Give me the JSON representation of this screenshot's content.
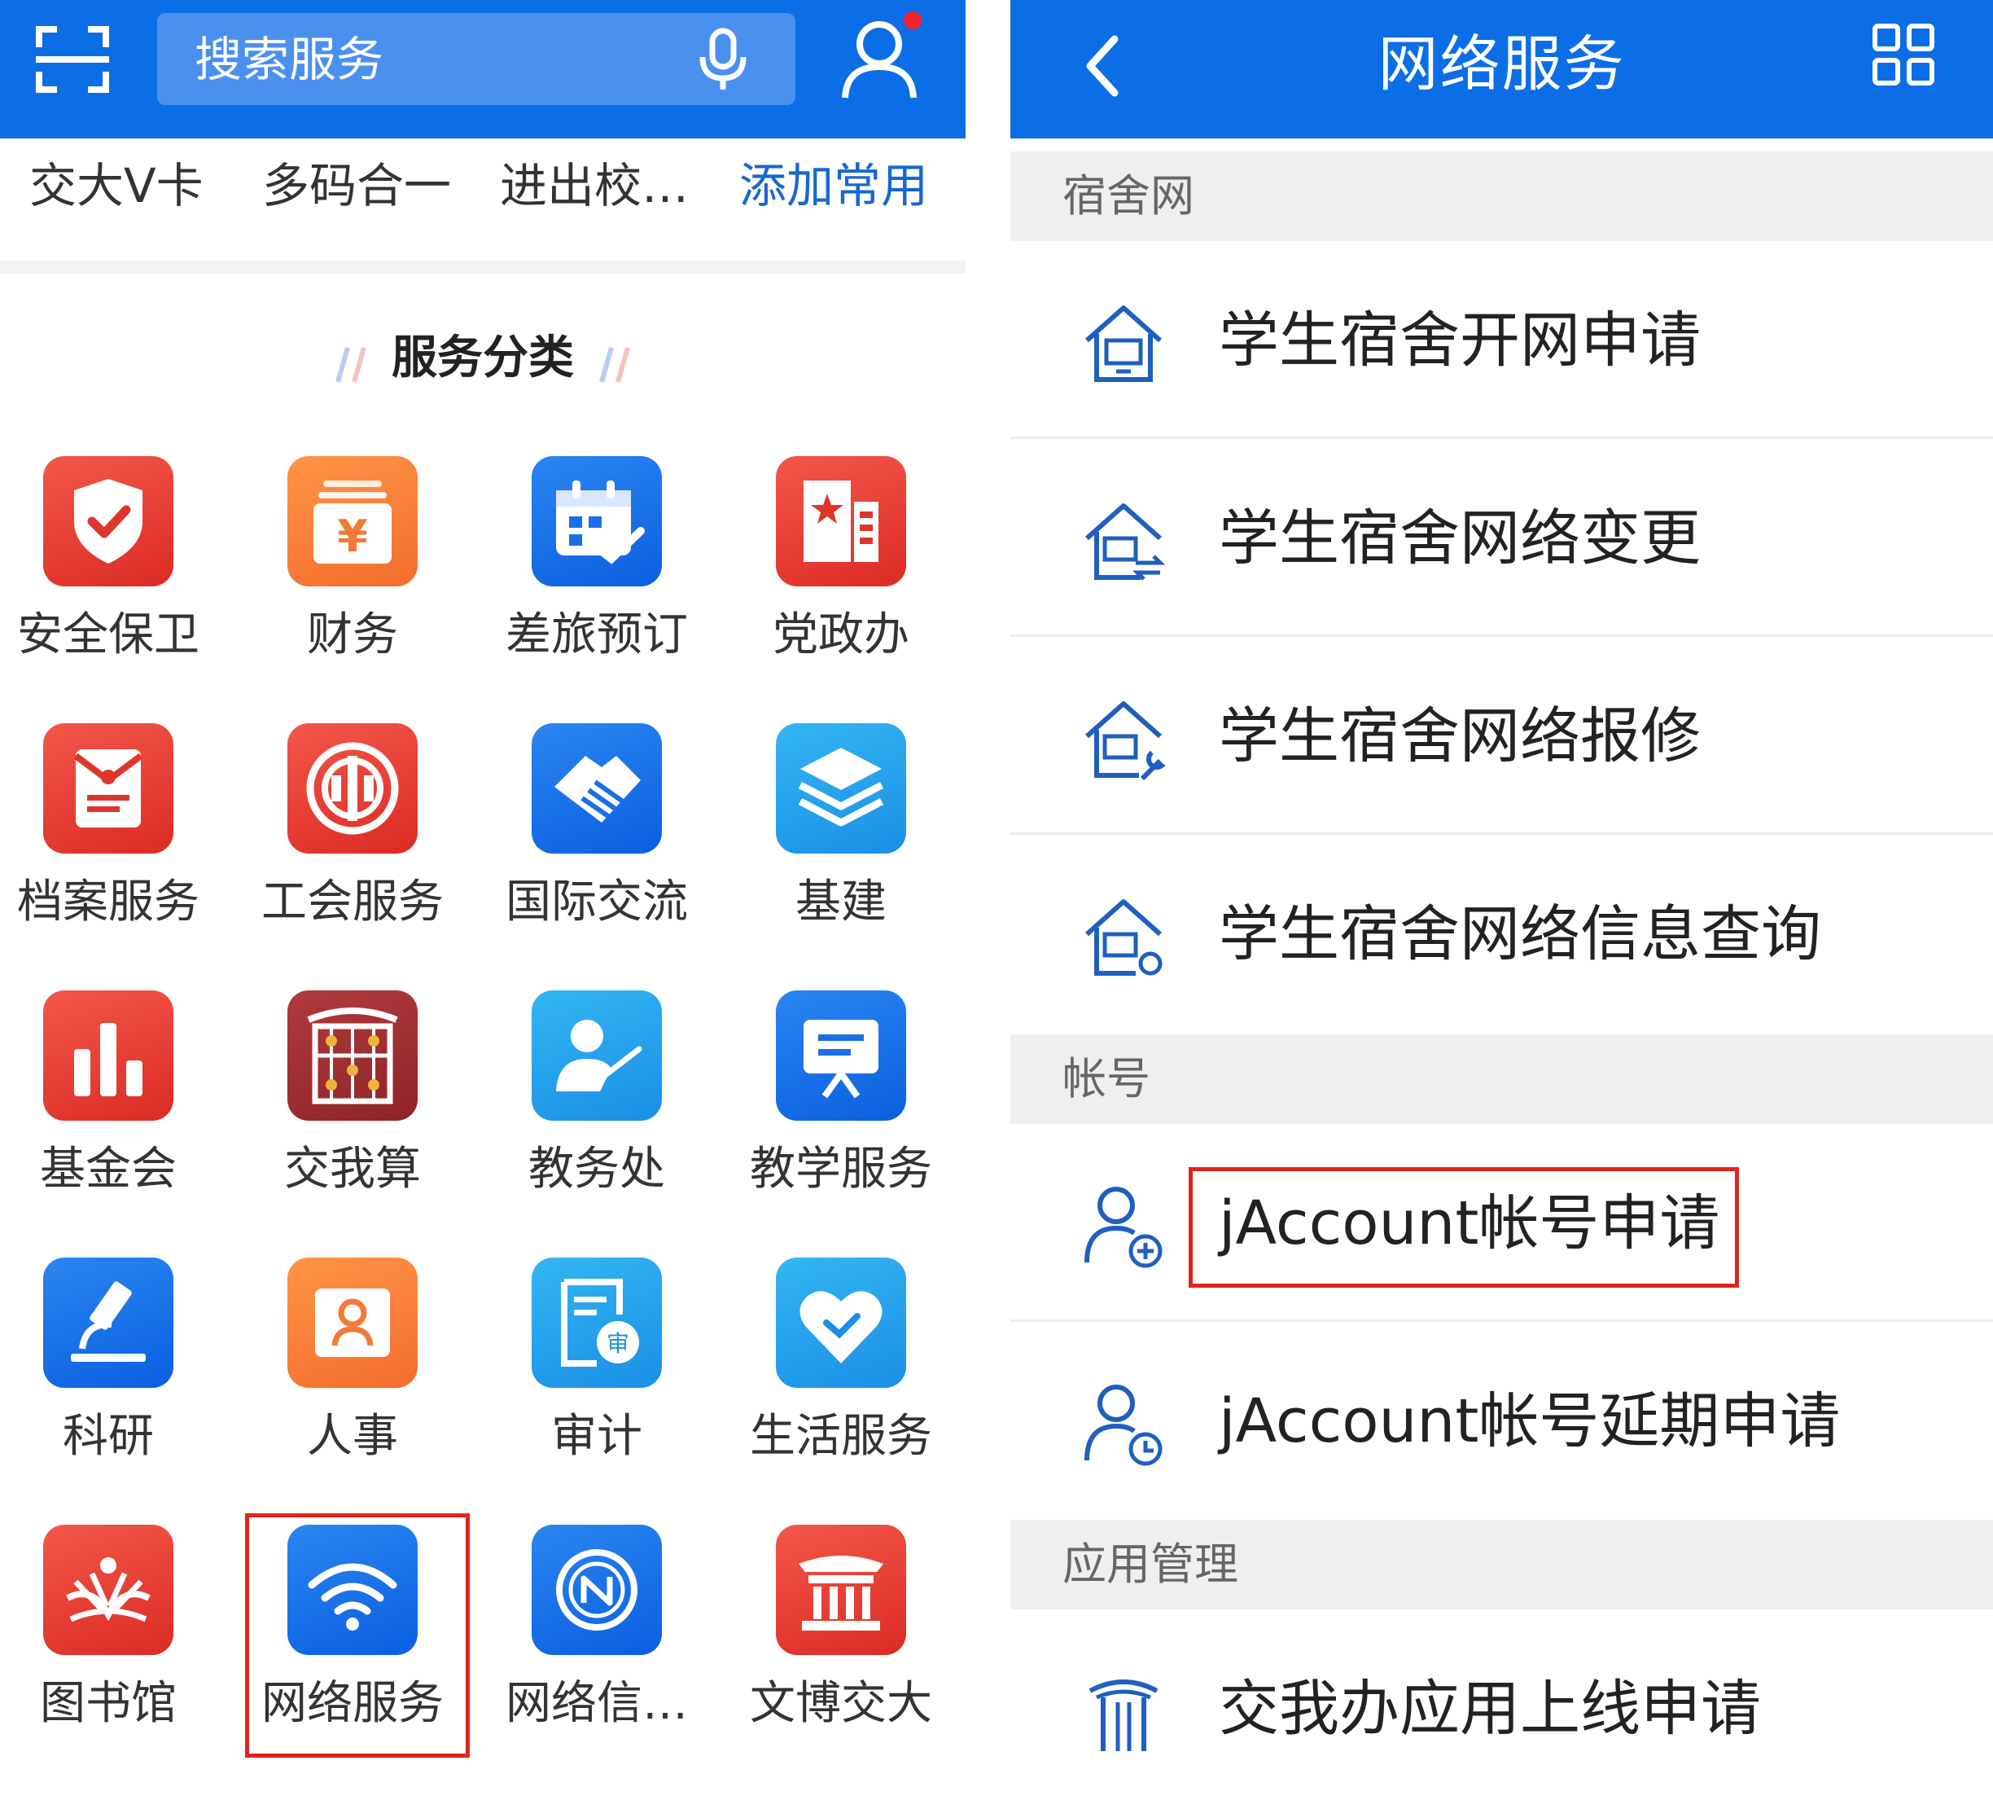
{
  "left": {
    "search": {
      "placeholder": "搜索服务"
    },
    "quick": [
      "交大V卡",
      "多码合一",
      "进出校…",
      "添加常用"
    ],
    "section_title": "服务分类",
    "services": [
      {
        "label": "安全保卫",
        "icon": "shield-check-icon",
        "color": "red"
      },
      {
        "label": "财务",
        "icon": "yuan-box-icon",
        "color": "orange"
      },
      {
        "label": "差旅预订",
        "icon": "calendar-booking-icon",
        "color": "blue"
      },
      {
        "label": "党政办",
        "icon": "party-building-icon",
        "color": "red"
      },
      {
        "label": "档案服务",
        "icon": "archive-envelope-icon",
        "color": "red"
      },
      {
        "label": "工会服务",
        "icon": "union-emblem-icon",
        "color": "red"
      },
      {
        "label": "国际交流",
        "icon": "handshake-icon",
        "color": "blue"
      },
      {
        "label": "基建",
        "icon": "layers-icon",
        "color": "sky"
      },
      {
        "label": "基金会",
        "icon": "bar-chart-icon",
        "color": "red"
      },
      {
        "label": "交我算",
        "icon": "abacus-icon",
        "color": "maroon"
      },
      {
        "label": "教务处",
        "icon": "teacher-icon",
        "color": "sky"
      },
      {
        "label": "教学服务",
        "icon": "presentation-board-icon",
        "color": "blue"
      },
      {
        "label": "科研",
        "icon": "microscope-icon",
        "color": "blue"
      },
      {
        "label": "人事",
        "icon": "person-card-icon",
        "color": "orange"
      },
      {
        "label": "审计",
        "icon": "audit-document-icon",
        "color": "sky"
      },
      {
        "label": "生活服务",
        "icon": "heart-icon",
        "color": "sky"
      },
      {
        "label": "图书馆",
        "icon": "library-emblem-icon",
        "color": "red"
      },
      {
        "label": "网络服务",
        "icon": "wifi-icon",
        "color": "blue"
      },
      {
        "label": "网络信…",
        "icon": "network-info-icon",
        "color": "blue"
      },
      {
        "label": "文博交大",
        "icon": "museum-gate-icon",
        "color": "red"
      }
    ]
  },
  "right": {
    "title": "网络服务",
    "groups": [
      {
        "name": "宿舍网",
        "items": [
          "学生宿舍开网申请",
          "学生宿舍网络变更",
          "学生宿舍网络报修",
          "学生宿舍网络信息查询"
        ]
      },
      {
        "name": "帐号",
        "items": [
          "jAccount帐号申请",
          "jAccount帐号延期申请"
        ]
      },
      {
        "name": "应用管理",
        "items": [
          "交我办应用上线申请"
        ]
      }
    ]
  },
  "colors": {
    "brand_blue": "#0b6ee6",
    "highlight_red": "#e0241b",
    "link_blue": "#1767d0"
  }
}
